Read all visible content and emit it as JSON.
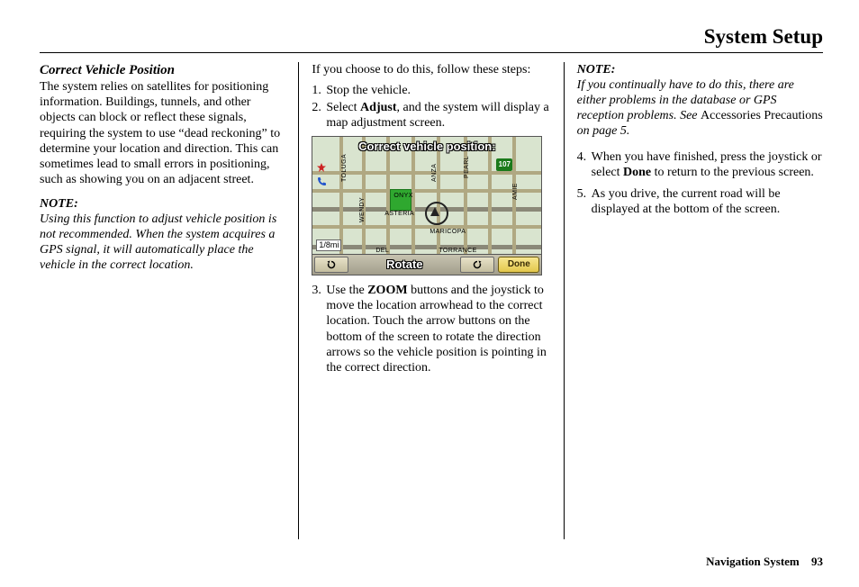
{
  "page_title": "System Setup",
  "footer": {
    "label": "Navigation System",
    "page": "93"
  },
  "col1": {
    "heading": "Correct Vehicle Position",
    "para1": "The system relies on satellites for positioning information. Buildings, tunnels, and other objects can block or reflect these signals, requiring the system to use “dead reckoning” to determine your location and direction. This can sometimes lead to small errors in positioning, such as showing you on an adjacent street.",
    "note_head": "NOTE:",
    "note_body": "Using this function to adjust vehicle position is not recommended. When the system acquires a GPS signal, it will automatically place the vehicle in the correct location."
  },
  "col2": {
    "intro": "If you choose to do this, follow these steps:",
    "steps": {
      "s1_num": "1.",
      "s1_txt": "Stop the vehicle.",
      "s2_num": "2.",
      "s2a": "Select ",
      "s2_bold": "Adjust",
      "s2b": ", and the system will display a map adjustment screen.",
      "s3_num": "3.",
      "s3a": "Use the ",
      "s3_bold": "ZOOM",
      "s3b": " buttons and the joystick to move the location arrowhead to the correct location. Touch the arrow buttons on the bottom of the screen to rotate the direction arrows so the vehicle position is pointing in the correct direction."
    },
    "map": {
      "title": "Correct vehicle position:",
      "scale": "1/8mi",
      "shield": "107",
      "rotate": "Rotate",
      "done": "Done",
      "streets": {
        "onyx": "ONYX",
        "asteria": "ASTERIA",
        "maricopa": "MARICOPA",
        "pearl": "PEARL",
        "wendy": "WENDY",
        "anza": "ANZA",
        "amie": "AMIE",
        "toluga": "TOLUGA",
        "torrance": "TORRANCE",
        "del": "DEL"
      }
    }
  },
  "col3": {
    "note_head": "NOTE:",
    "note_body_a": "If you continually have to do this, there are either problems in the database or GPS reception problems. See ",
    "note_body_plain": "Accessories Precautions",
    "note_body_b": " on page 5.",
    "s4_num": "4.",
    "s4a": "When you have finished, press the joystick or select ",
    "s4_bold": "Done",
    "s4b": " to return to the previous screen.",
    "s5_num": "5.",
    "s5_txt": "As you drive, the current road will be displayed at the bottom of the screen."
  }
}
